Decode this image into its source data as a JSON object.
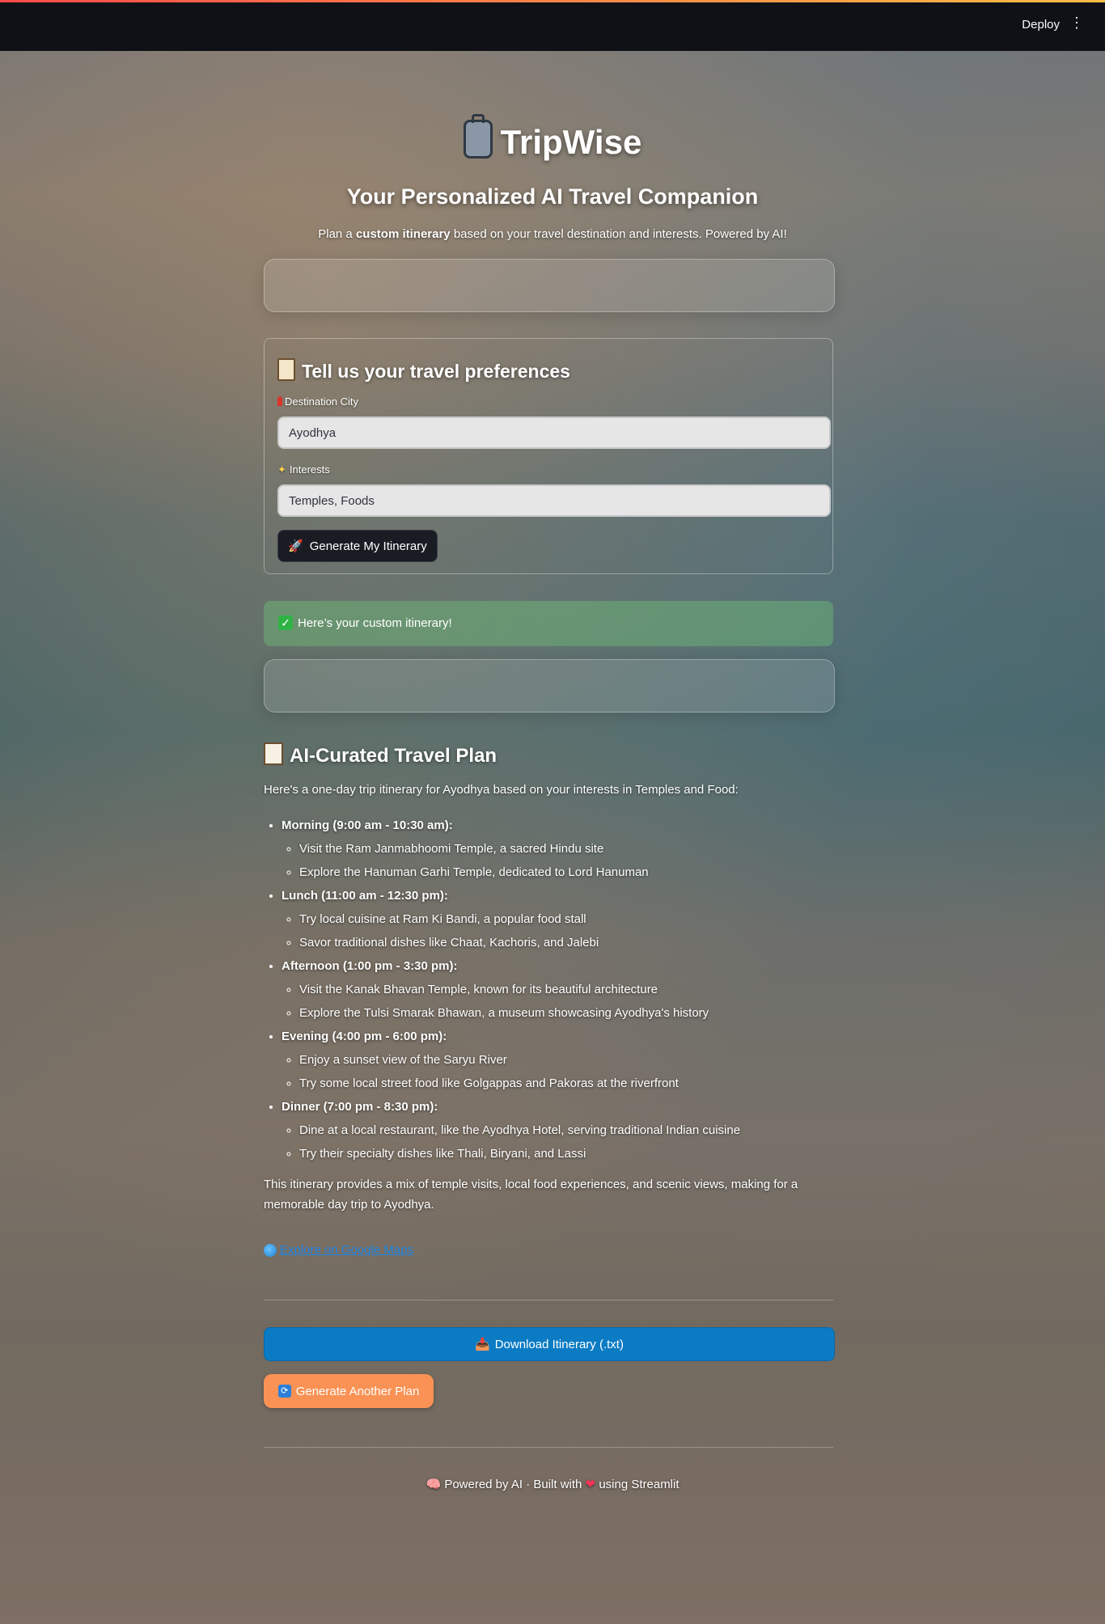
{
  "topbar": {
    "deploy_label": "Deploy",
    "menu_icon": "kebab-menu-icon"
  },
  "hero": {
    "title": "TripWise",
    "subtitle": "Your Personalized AI Travel Companion",
    "intro_prefix": "Plan a ",
    "intro_bold": "custom itinerary",
    "intro_suffix": " based on your travel destination and interests. Powered by AI!"
  },
  "form": {
    "heading": "Tell us your travel preferences",
    "destination_label": "Destination City",
    "destination_value": "Ayodhya",
    "interests_label": "Interests",
    "interests_value": "Temples, Foods",
    "submit_label": "Generate My Itinerary"
  },
  "success_message": "Here’s your custom itinerary!",
  "plan": {
    "heading": "AI-Curated Travel Plan",
    "intro": "Here's a one-day trip itinerary for Ayodhya based on your interests in Temples and Food:",
    "sections": [
      {
        "title": "Morning (9:00 am - 10:30 am):",
        "items": [
          "Visit the Ram Janmabhoomi Temple, a sacred Hindu site",
          "Explore the Hanuman Garhi Temple, dedicated to Lord Hanuman"
        ]
      },
      {
        "title": "Lunch (11:00 am - 12:30 pm):",
        "items": [
          "Try local cuisine at Ram Ki Bandi, a popular food stall",
          "Savor traditional dishes like Chaat, Kachoris, and Jalebi"
        ]
      },
      {
        "title": "Afternoon (1:00 pm - 3:30 pm):",
        "items": [
          "Visit the Kanak Bhavan Temple, known for its beautiful architecture",
          "Explore the Tulsi Smarak Bhawan, a museum showcasing Ayodhya's history"
        ]
      },
      {
        "title": "Evening (4:00 pm - 6:00 pm):",
        "items": [
          "Enjoy a sunset view of the Saryu River",
          "Try some local street food like Golgappas and Pakoras at the riverfront"
        ]
      },
      {
        "title": "Dinner (7:00 pm - 8:30 pm):",
        "items": [
          "Dine at a local restaurant, like the Ayodhya Hotel, serving traditional Indian cuisine",
          "Try their specialty dishes like Thali, Biryani, and Lassi"
        ]
      }
    ],
    "summary": "This itinerary provides a mix of temple visits, local food experiences, and scenic views, making for a memorable day trip to Ayodhya."
  },
  "maps_link_label": "Explore on Google Maps",
  "download_label": "Download Itinerary (.txt)",
  "another_plan_label": "Generate Another Plan",
  "footer": {
    "part1": "Powered by AI · Built with",
    "part2": "using Streamlit"
  },
  "colors": {
    "accent_blue": "#0b7bc4",
    "accent_orange": "#f99254",
    "success_green": "#6ebe78",
    "topbar": "#0f1117"
  }
}
